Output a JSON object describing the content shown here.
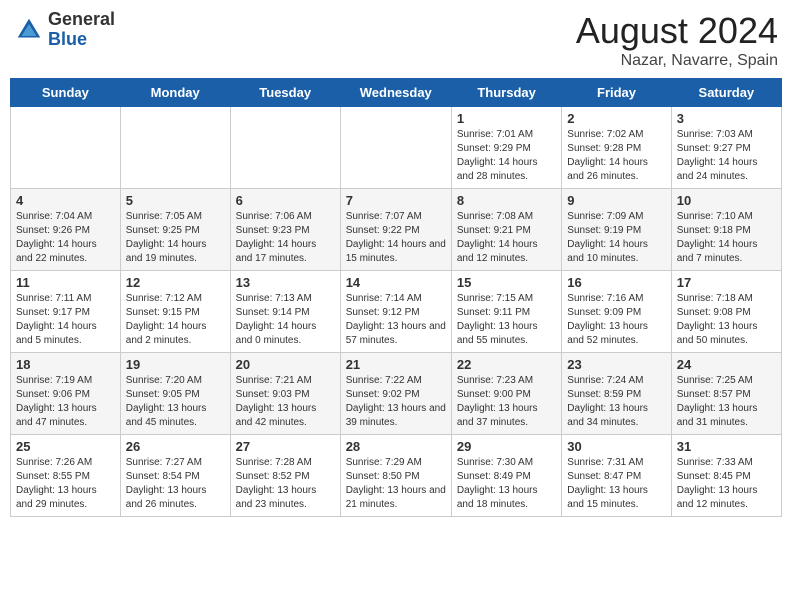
{
  "header": {
    "logo_general": "General",
    "logo_blue": "Blue",
    "month_year": "August 2024",
    "location": "Nazar, Navarre, Spain"
  },
  "weekdays": [
    "Sunday",
    "Monday",
    "Tuesday",
    "Wednesday",
    "Thursday",
    "Friday",
    "Saturday"
  ],
  "weeks": [
    [
      {
        "day": "",
        "info": ""
      },
      {
        "day": "",
        "info": ""
      },
      {
        "day": "",
        "info": ""
      },
      {
        "day": "",
        "info": ""
      },
      {
        "day": "1",
        "info": "Sunrise: 7:01 AM\nSunset: 9:29 PM\nDaylight: 14 hours and 28 minutes."
      },
      {
        "day": "2",
        "info": "Sunrise: 7:02 AM\nSunset: 9:28 PM\nDaylight: 14 hours and 26 minutes."
      },
      {
        "day": "3",
        "info": "Sunrise: 7:03 AM\nSunset: 9:27 PM\nDaylight: 14 hours and 24 minutes."
      }
    ],
    [
      {
        "day": "4",
        "info": "Sunrise: 7:04 AM\nSunset: 9:26 PM\nDaylight: 14 hours and 22 minutes."
      },
      {
        "day": "5",
        "info": "Sunrise: 7:05 AM\nSunset: 9:25 PM\nDaylight: 14 hours and 19 minutes."
      },
      {
        "day": "6",
        "info": "Sunrise: 7:06 AM\nSunset: 9:23 PM\nDaylight: 14 hours and 17 minutes."
      },
      {
        "day": "7",
        "info": "Sunrise: 7:07 AM\nSunset: 9:22 PM\nDaylight: 14 hours and 15 minutes."
      },
      {
        "day": "8",
        "info": "Sunrise: 7:08 AM\nSunset: 9:21 PM\nDaylight: 14 hours and 12 minutes."
      },
      {
        "day": "9",
        "info": "Sunrise: 7:09 AM\nSunset: 9:19 PM\nDaylight: 14 hours and 10 minutes."
      },
      {
        "day": "10",
        "info": "Sunrise: 7:10 AM\nSunset: 9:18 PM\nDaylight: 14 hours and 7 minutes."
      }
    ],
    [
      {
        "day": "11",
        "info": "Sunrise: 7:11 AM\nSunset: 9:17 PM\nDaylight: 14 hours and 5 minutes."
      },
      {
        "day": "12",
        "info": "Sunrise: 7:12 AM\nSunset: 9:15 PM\nDaylight: 14 hours and 2 minutes."
      },
      {
        "day": "13",
        "info": "Sunrise: 7:13 AM\nSunset: 9:14 PM\nDaylight: 14 hours and 0 minutes."
      },
      {
        "day": "14",
        "info": "Sunrise: 7:14 AM\nSunset: 9:12 PM\nDaylight: 13 hours and 57 minutes."
      },
      {
        "day": "15",
        "info": "Sunrise: 7:15 AM\nSunset: 9:11 PM\nDaylight: 13 hours and 55 minutes."
      },
      {
        "day": "16",
        "info": "Sunrise: 7:16 AM\nSunset: 9:09 PM\nDaylight: 13 hours and 52 minutes."
      },
      {
        "day": "17",
        "info": "Sunrise: 7:18 AM\nSunset: 9:08 PM\nDaylight: 13 hours and 50 minutes."
      }
    ],
    [
      {
        "day": "18",
        "info": "Sunrise: 7:19 AM\nSunset: 9:06 PM\nDaylight: 13 hours and 47 minutes."
      },
      {
        "day": "19",
        "info": "Sunrise: 7:20 AM\nSunset: 9:05 PM\nDaylight: 13 hours and 45 minutes."
      },
      {
        "day": "20",
        "info": "Sunrise: 7:21 AM\nSunset: 9:03 PM\nDaylight: 13 hours and 42 minutes."
      },
      {
        "day": "21",
        "info": "Sunrise: 7:22 AM\nSunset: 9:02 PM\nDaylight: 13 hours and 39 minutes."
      },
      {
        "day": "22",
        "info": "Sunrise: 7:23 AM\nSunset: 9:00 PM\nDaylight: 13 hours and 37 minutes."
      },
      {
        "day": "23",
        "info": "Sunrise: 7:24 AM\nSunset: 8:59 PM\nDaylight: 13 hours and 34 minutes."
      },
      {
        "day": "24",
        "info": "Sunrise: 7:25 AM\nSunset: 8:57 PM\nDaylight: 13 hours and 31 minutes."
      }
    ],
    [
      {
        "day": "25",
        "info": "Sunrise: 7:26 AM\nSunset: 8:55 PM\nDaylight: 13 hours and 29 minutes."
      },
      {
        "day": "26",
        "info": "Sunrise: 7:27 AM\nSunset: 8:54 PM\nDaylight: 13 hours and 26 minutes."
      },
      {
        "day": "27",
        "info": "Sunrise: 7:28 AM\nSunset: 8:52 PM\nDaylight: 13 hours and 23 minutes."
      },
      {
        "day": "28",
        "info": "Sunrise: 7:29 AM\nSunset: 8:50 PM\nDaylight: 13 hours and 21 minutes."
      },
      {
        "day": "29",
        "info": "Sunrise: 7:30 AM\nSunset: 8:49 PM\nDaylight: 13 hours and 18 minutes."
      },
      {
        "day": "30",
        "info": "Sunrise: 7:31 AM\nSunset: 8:47 PM\nDaylight: 13 hours and 15 minutes."
      },
      {
        "day": "31",
        "info": "Sunrise: 7:33 AM\nSunset: 8:45 PM\nDaylight: 13 hours and 12 minutes."
      }
    ]
  ]
}
